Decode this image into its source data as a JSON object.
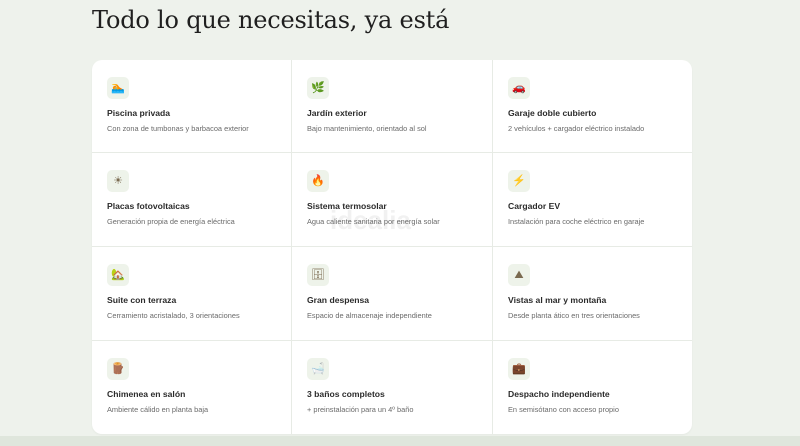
{
  "heading": "Todo lo que necesitas, ya está",
  "watermark": "idealia",
  "features": [
    {
      "icon": "pool-float-icon",
      "glyph": "🏊",
      "title": "Piscina privada",
      "desc": "Con zona de tumbonas y barbacoa exterior"
    },
    {
      "icon": "leaf-icon",
      "glyph": "🌿",
      "title": "Jardín exterior",
      "desc": "Bajo mantenimiento, orientado al sol"
    },
    {
      "icon": "car-icon",
      "glyph": "🚗",
      "title": "Garaje doble cubierto",
      "desc": "2 vehículos + cargador eléctrico instalado"
    },
    {
      "icon": "sun-icon",
      "glyph": "☀",
      "title": "Placas fotovoltaicas",
      "desc": "Generación propia de energía eléctrica"
    },
    {
      "icon": "flame-icon",
      "glyph": "🔥",
      "title": "Sistema termosolar",
      "desc": "Agua caliente sanitaria por energía solar"
    },
    {
      "icon": "lightning-icon",
      "glyph": "⚡",
      "title": "Cargador EV",
      "desc": "Instalación para coche eléctrico en garaje"
    },
    {
      "icon": "house-plant-icon",
      "glyph": "🏡",
      "title": "Suite con terraza",
      "desc": "Cerramiento acristalado, 3 orientaciones"
    },
    {
      "icon": "cabinet-icon",
      "glyph": "🗄",
      "title": "Gran despensa",
      "desc": "Espacio de almacenaje independiente"
    },
    {
      "icon": "sea-view-icon",
      "glyph": "⛰",
      "title": "Vistas al mar y montaña",
      "desc": "Desde planta ático en tres orientaciones"
    },
    {
      "icon": "firewood-icon",
      "glyph": "🪵",
      "title": "Chimenea en salón",
      "desc": "Ambiente cálido en planta baja"
    },
    {
      "icon": "bathtub-icon",
      "glyph": "🛁",
      "title": "3 baños completos",
      "desc": "+ preinstalación para un 4º baño"
    },
    {
      "icon": "briefcase-icon",
      "glyph": "💼",
      "title": "Despacho independiente",
      "desc": "En semisótano con acceso propio"
    }
  ]
}
